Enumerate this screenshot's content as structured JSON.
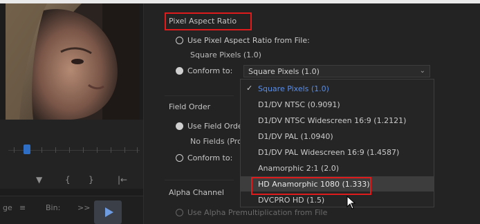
{
  "pixel_aspect_ratio": {
    "heading": "Pixel Aspect Ratio",
    "option_from_file": "Use Pixel Aspect Ratio from File:",
    "from_file_value": "Square Pixels (1.0)",
    "option_conform": "Conform to:",
    "conform_selected": "Square Pixels (1.0)",
    "dropdown_options": [
      "Square Pixels (1.0)",
      "D1/DV NTSC (0.9091)",
      "D1/DV NTSC Widescreen 16:9 (1.2121)",
      "D1/DV PAL (1.0940)",
      "D1/DV PAL Widescreen 16:9 (1.4587)",
      "Anamorphic 2:1 (2.0)",
      "HD Anamorphic 1080 (1.333)",
      "DVCPRO HD (1.5)"
    ],
    "highlighted_option": "HD Anamorphic 1080 (1.333)"
  },
  "field_order": {
    "heading": "Field Order",
    "option_from_file": "Use Field Orde",
    "from_file_value": "No Fields (Pro",
    "option_conform": "Conform to:"
  },
  "alpha_channel": {
    "heading": "Alpha Channel",
    "option_premultiplication": "Use Alpha Premultiplication from File"
  },
  "left_panel": {
    "tab_partial": "ge",
    "tab_bin": "Bin:",
    "tab_more": ">>"
  },
  "colors": {
    "annotation_red": "#e01b1b",
    "selected_blue": "#5b8ee6",
    "playhead_blue": "#2f6ec5"
  }
}
